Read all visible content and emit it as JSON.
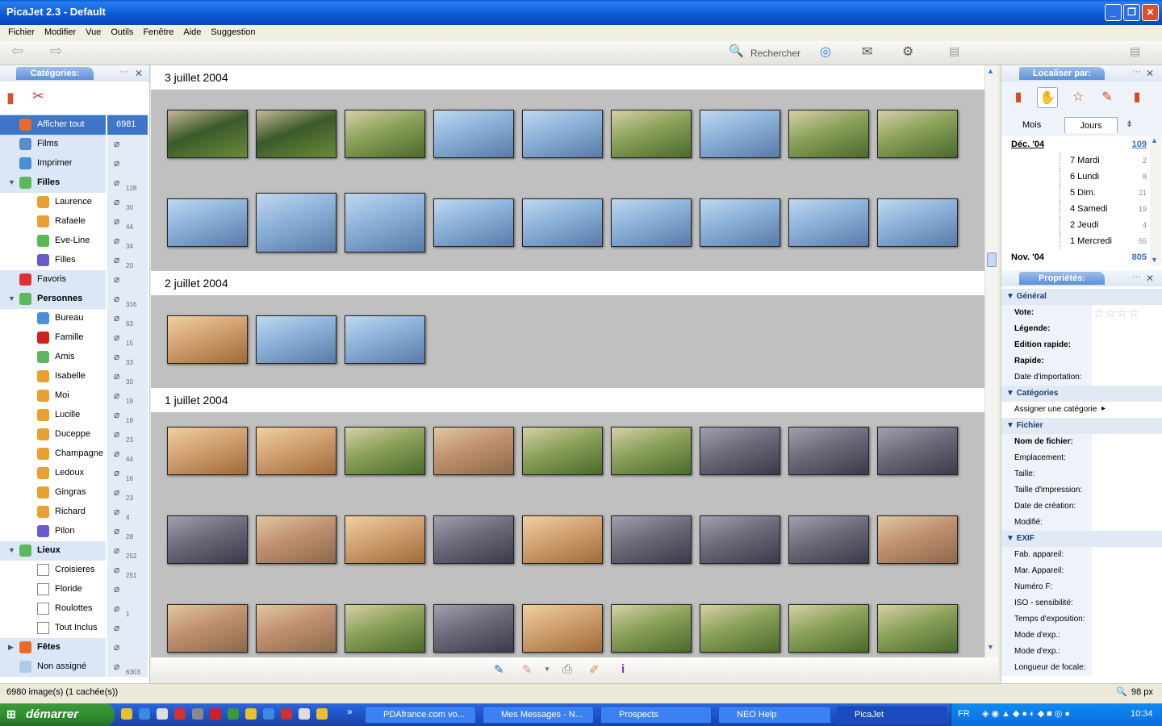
{
  "window": {
    "title": "PicaJet 2.3 - Default"
  },
  "menu": [
    "Fichier",
    "Modifier",
    "Vue",
    "Outils",
    "Fenêtre",
    "Aide",
    "Suggestion"
  ],
  "toolbar": {
    "search_label": "Rechercher"
  },
  "categories": {
    "title": "Catégories:",
    "items": [
      {
        "label": "Afficher tout",
        "count": "6981",
        "level": 0,
        "selected": true,
        "bold": false
      },
      {
        "label": "Films",
        "count": "",
        "level": 0,
        "bold": false
      },
      {
        "label": "Imprimer",
        "count": "",
        "level": 0,
        "bold": false
      },
      {
        "label": "Filles",
        "count": "128",
        "level": 0,
        "bold": true,
        "expanded": true
      },
      {
        "label": "Laurence",
        "count": "30",
        "level": 1
      },
      {
        "label": "Rafaele",
        "count": "44",
        "level": 1
      },
      {
        "label": "Eve-Line",
        "count": "34",
        "level": 1
      },
      {
        "label": "Filles",
        "count": "20",
        "level": 1
      },
      {
        "label": "Favoris",
        "count": "",
        "level": 0,
        "bold": false
      },
      {
        "label": "Personnes",
        "count": "316",
        "level": 0,
        "bold": true,
        "expanded": true
      },
      {
        "label": "Bureau",
        "count": "63",
        "level": 1
      },
      {
        "label": "Famille",
        "count": "15",
        "level": 1
      },
      {
        "label": "Amis",
        "count": "33",
        "level": 1
      },
      {
        "label": "Isabelle",
        "count": "30",
        "level": 1
      },
      {
        "label": "Moi",
        "count": "19",
        "level": 1
      },
      {
        "label": "Lucille",
        "count": "18",
        "level": 1
      },
      {
        "label": "Duceppe",
        "count": "23",
        "level": 1
      },
      {
        "label": "Champagne",
        "count": "44",
        "level": 1
      },
      {
        "label": "Ledoux",
        "count": "16",
        "level": 1
      },
      {
        "label": "Gingras",
        "count": "23",
        "level": 1
      },
      {
        "label": "Richard",
        "count": "4",
        "level": 1
      },
      {
        "label": "Pilon",
        "count": "28",
        "level": 1
      },
      {
        "label": "Lieux",
        "count": "252",
        "level": 0,
        "bold": true,
        "expanded": true
      },
      {
        "label": "Croisieres",
        "count": "251",
        "level": 1
      },
      {
        "label": "Floride",
        "count": "",
        "level": 1
      },
      {
        "label": "Roulottes",
        "count": "1",
        "level": 1
      },
      {
        "label": "Tout Inclus",
        "count": "",
        "level": 1
      },
      {
        "label": "Fêtes",
        "count": "",
        "level": 0,
        "bold": true,
        "expanded": false
      },
      {
        "label": "Non assigné",
        "count": "6303",
        "level": 0,
        "bold": false
      }
    ]
  },
  "days": [
    {
      "label": "3 juillet 2004"
    },
    {
      "label": "2 juillet 2004"
    },
    {
      "label": "1 juillet 2004"
    }
  ],
  "localiser": {
    "title": "Localiser par:",
    "tabs": [
      "Mois",
      "Jours"
    ],
    "dates": [
      {
        "label": "Déc. '04",
        "count": "109",
        "top": true
      },
      {
        "label": "7 Mardi",
        "count": "2"
      },
      {
        "label": "6 Lundi",
        "count": "8"
      },
      {
        "label": "5 Dim.",
        "count": "21"
      },
      {
        "label": "4 Samedi",
        "count": "19"
      },
      {
        "label": "2 Jeudi",
        "count": "4"
      },
      {
        "label": "1 Mercredi",
        "count": "55"
      },
      {
        "label": "Nov. '04",
        "count": "805",
        "top": true
      }
    ]
  },
  "properties": {
    "title": "Propriétés:",
    "sections": [
      {
        "name": "Général",
        "rows": [
          {
            "k": "Vote:",
            "b": true
          },
          {
            "k": "Légende:",
            "b": true
          },
          {
            "k": "Edition rapide:",
            "b": true
          },
          {
            "k": "Rapide:",
            "b": true
          },
          {
            "k": "Date d'importation:",
            "b": false
          }
        ]
      },
      {
        "name": "Catégories",
        "rows": [
          {
            "k": "Assigner une catégorie",
            "b": false,
            "wide": true
          }
        ]
      },
      {
        "name": "Fichier",
        "rows": [
          {
            "k": "Nom de fichier:",
            "b": true
          },
          {
            "k": "Emplacement:",
            "b": false
          },
          {
            "k": "Taille:",
            "b": false
          },
          {
            "k": "Taille d'impression:",
            "b": false
          },
          {
            "k": "Date de création:",
            "b": false
          },
          {
            "k": "Modifié:",
            "b": false
          }
        ]
      },
      {
        "name": "EXIF",
        "rows": [
          {
            "k": "Fab. appareil:",
            "b": false
          },
          {
            "k": "Mar. Appareil:",
            "b": false
          },
          {
            "k": "Numéro F:",
            "b": false
          },
          {
            "k": "ISO - sensibilité:",
            "b": false
          },
          {
            "k": "Temps d'exposition:",
            "b": false
          },
          {
            "k": "Mode d'exp.:",
            "b": false
          },
          {
            "k": "Mode d'exp.:",
            "b": false
          },
          {
            "k": "Longueur de focale:",
            "b": false
          }
        ]
      }
    ]
  },
  "status": {
    "left": "6980 image(s) (1 cachée(s))",
    "zoom": "98 px"
  },
  "taskbar": {
    "start": "démarrer",
    "tasks": [
      "PDAfrance.com vo...",
      "Mes Messages - N...",
      "Prospects",
      "NEO Help",
      "PicaJet"
    ],
    "lang": "FR",
    "clock": "10:34"
  }
}
